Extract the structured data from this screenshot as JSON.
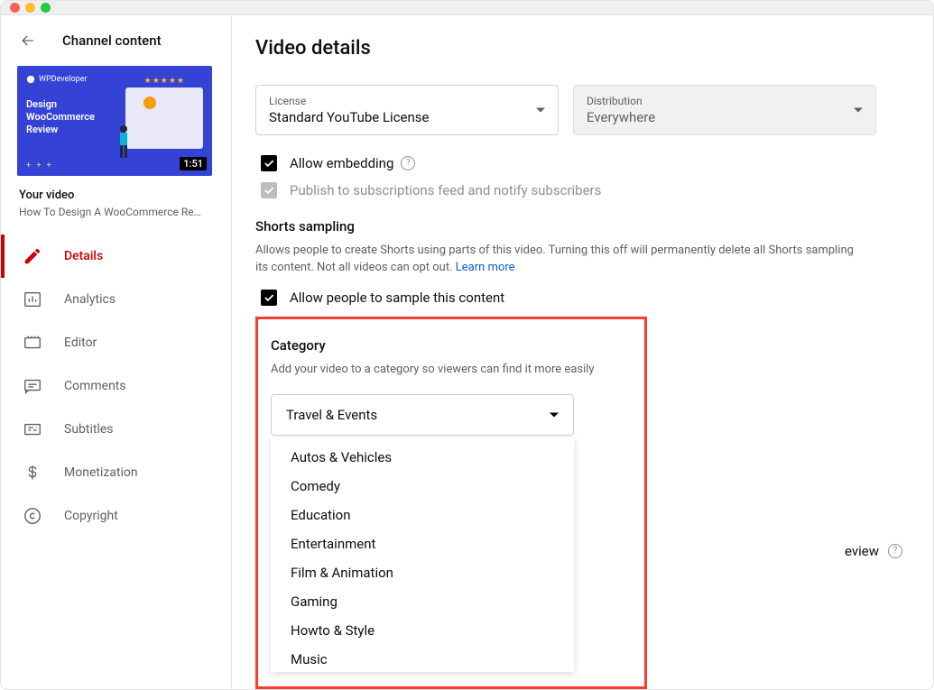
{
  "sidebar": {
    "title": "Channel content",
    "thumbnail": {
      "brand": "WPDeveloper",
      "overlay_title": "Design\nWooCommerce\nReview",
      "duration": "1:51"
    },
    "your_video_label": "Your video",
    "video_title": "How To Design A WooCommerce Re…",
    "nav": [
      {
        "key": "details",
        "label": "Details"
      },
      {
        "key": "analytics",
        "label": "Analytics"
      },
      {
        "key": "editor",
        "label": "Editor"
      },
      {
        "key": "comments",
        "label": "Comments"
      },
      {
        "key": "subtitles",
        "label": "Subtitles"
      },
      {
        "key": "monetization",
        "label": "Monetization"
      },
      {
        "key": "copyright",
        "label": "Copyright"
      }
    ]
  },
  "main": {
    "page_title": "Video details",
    "license": {
      "label": "License",
      "value": "Standard YouTube License"
    },
    "distribution": {
      "label": "Distribution",
      "value": "Everywhere"
    },
    "allow_embedding": "Allow embedding",
    "publish_notify": "Publish to subscriptions feed and notify subscribers",
    "shorts": {
      "heading": "Shorts sampling",
      "desc": "Allows people to create Shorts using parts of this video. Turning this off will permanently delete all Shorts sampling its content. Not all videos can opt out. ",
      "learn_more": "Learn more",
      "checkbox_label": "Allow people to sample this content"
    },
    "category": {
      "heading": "Category",
      "desc": "Add your video to a category so viewers can find it more easily",
      "selected": "Travel & Events",
      "options": [
        "Autos & Vehicles",
        "Comedy",
        "Education",
        "Entertainment",
        "Film & Animation",
        "Gaming",
        "Howto & Style",
        "Music"
      ]
    },
    "obscured_text": "eview"
  }
}
